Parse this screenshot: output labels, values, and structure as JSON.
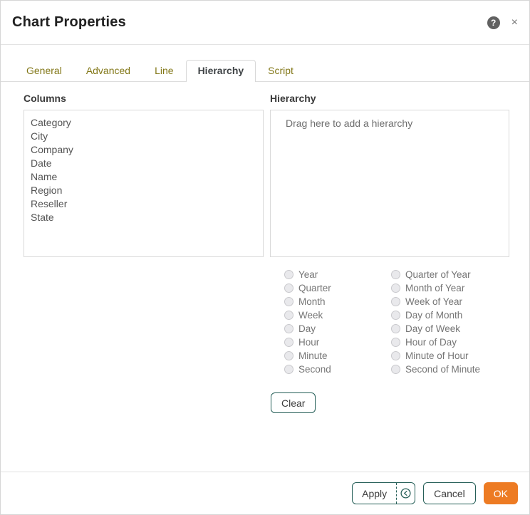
{
  "dialog": {
    "title": "Chart Properties"
  },
  "icons": {
    "help_glyph": "?",
    "close_glyph": "×",
    "apply_menu_icon": "history-chevron-in-circle"
  },
  "tabs": [
    {
      "label": "General",
      "active": false
    },
    {
      "label": "Advanced",
      "active": false
    },
    {
      "label": "Line",
      "active": false
    },
    {
      "label": "Hierarchy",
      "active": true
    },
    {
      "label": "Script",
      "active": false
    }
  ],
  "columns_panel": {
    "label": "Columns",
    "items": [
      "Category",
      "City",
      "Company",
      "Date",
      "Name",
      "Region",
      "Reseller",
      "State"
    ]
  },
  "hierarchy_panel": {
    "label": "Hierarchy",
    "placeholder": "Drag here to add a hierarchy"
  },
  "date_levels": {
    "selected": null,
    "left": [
      "Year",
      "Quarter",
      "Month",
      "Week",
      "Day",
      "Hour",
      "Minute",
      "Second"
    ],
    "right": [
      "Quarter of Year",
      "Month of Year",
      "Week of Year",
      "Day of Month",
      "Day of Week",
      "Hour of Day",
      "Minute of Hour",
      "Second of Minute"
    ]
  },
  "buttons": {
    "clear": "Clear",
    "apply": "Apply",
    "cancel": "Cancel",
    "ok": "OK"
  },
  "colors": {
    "accent_teal": "#265F58",
    "ok_orange": "#ED7B23",
    "tab_inactive_olive": "#827717",
    "tab_active_gray": "#3F4346"
  }
}
